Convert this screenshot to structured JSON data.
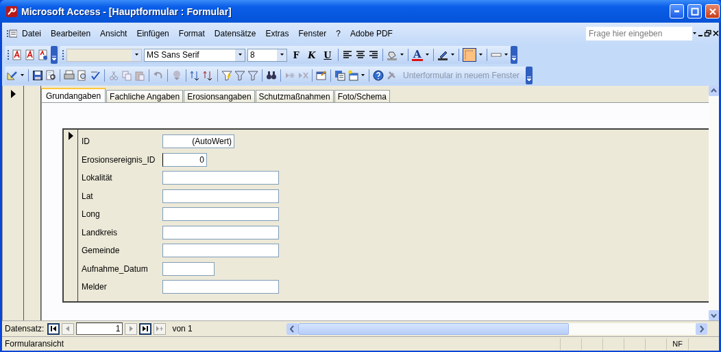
{
  "window": {
    "title": "Microsoft Access - [Hauptformular : Formular]"
  },
  "menu_bar": {
    "items": [
      "Datei",
      "Bearbeiten",
      "Ansicht",
      "Einfügen",
      "Format",
      "Datensätze",
      "Extras",
      "Fenster",
      "?",
      "Adobe PDF"
    ],
    "help_search": {
      "placeholder": "Frage hier eingeben"
    }
  },
  "formatting_toolbar": {
    "object_combo": {
      "disabled": true
    },
    "font": "MS Sans Serif",
    "size": "8",
    "style_buttons": [
      "F",
      "K",
      "U"
    ],
    "font_color_glyph": "A",
    "border_button": {
      "selected": true
    }
  },
  "form_toolbar": {
    "subform_button": {
      "label": "Unterformular in neuem Fenster",
      "disabled": true
    }
  },
  "tabs": [
    {
      "label": "Grundangaben",
      "selected": true
    },
    {
      "label": "Fachliche Angaben",
      "selected": false
    },
    {
      "label": "Erosionsangaben",
      "selected": false
    },
    {
      "label": "Schutzmaßnahmen",
      "selected": false
    },
    {
      "label": "Foto/Schema",
      "selected": false
    }
  ],
  "subform": {
    "fields": [
      {
        "label": "ID",
        "kind": "autonumber",
        "value": "(AutoWert)"
      },
      {
        "label": "Erosionsereignis_ID",
        "kind": "number",
        "value": "0",
        "focused": true
      },
      {
        "label": "Lokalität",
        "kind": "text"
      },
      {
        "label": "Lat",
        "kind": "text"
      },
      {
        "label": "Long",
        "kind": "text"
      },
      {
        "label": "Landkreis",
        "kind": "text"
      },
      {
        "label": "Gemeinde",
        "kind": "text"
      },
      {
        "label": "Aufnahme_Datum",
        "kind": "date"
      },
      {
        "label": "Melder",
        "kind": "text"
      }
    ]
  },
  "record_navigator": {
    "label": "Datensatz:",
    "current": "1",
    "total": "von 1"
  },
  "status_bar": {
    "text": "Formularansicht",
    "indicators": [
      "NF"
    ]
  }
}
